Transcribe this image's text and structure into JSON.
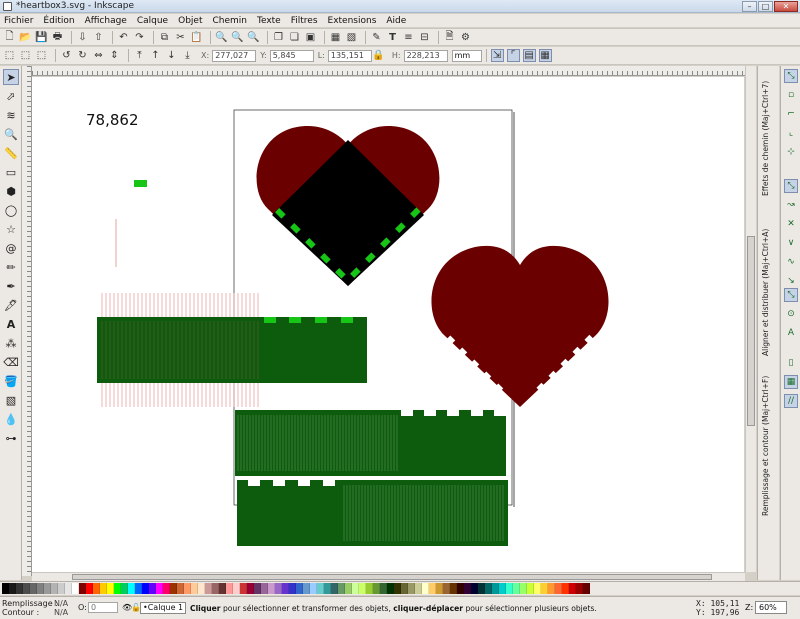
{
  "window": {
    "title": "*heartbox3.svg - Inkscape",
    "controls": [
      "–",
      "□",
      "✕"
    ]
  },
  "menu": [
    "Fichier",
    "Édition",
    "Affichage",
    "Calque",
    "Objet",
    "Chemin",
    "Texte",
    "Filtres",
    "Extensions",
    "Aide"
  ],
  "controls_bar": {
    "x_label": "X:",
    "x_value": "277,027",
    "y_label": "Y:",
    "y_value": "5,845",
    "w_label": "L:",
    "w_value": "135,151",
    "h_label": "H:",
    "h_value": "228,213",
    "unit": "mm"
  },
  "canvas": {
    "measure_text": "78,862"
  },
  "docks": {
    "fill_stroke": "Remplissage et contour (Maj+Ctrl+F)",
    "align": "Aligner et distribuer (Maj+Ctrl+A)",
    "path_effects": "Effets de chemin (Maj+Ctrl+7)"
  },
  "status": {
    "fill_label": "Remplissage :",
    "fill_value": "N/A",
    "stroke_label": "Contour :",
    "stroke_value": "N/A",
    "opacity_label": "O:",
    "opacity_value": "0",
    "layer": "•Calque 1",
    "msg_b1": "Cliquer",
    "msg_t1": " pour sélectionner et transformer des objets, ",
    "msg_b2": "cliquer-déplacer",
    "msg_t2": " pour sélectionner plusieurs objets.",
    "x_label": "X:",
    "x_value": "105,11",
    "y_label": "Y:",
    "y_value": "197,96",
    "zoom_label": "Z:",
    "zoom_value": "60%"
  },
  "colors": {
    "heart": "#6b0000",
    "board_green": "#0d5c0d",
    "tab_green": "#16c516",
    "cut_red": "#e8a3a3",
    "black": "#000000"
  },
  "palette": [
    "#000000",
    "#1a1a1a",
    "#333333",
    "#4d4d4d",
    "#666666",
    "#808080",
    "#999999",
    "#b3b3b3",
    "#cccccc",
    "#e6e6e6",
    "#ffffff",
    "#800000",
    "#ff0000",
    "#ff6600",
    "#ffcc00",
    "#ffff00",
    "#00ff00",
    "#00cc66",
    "#00ffff",
    "#0066ff",
    "#0000ff",
    "#6600ff",
    "#ff00ff",
    "#ff0066",
    "#993300",
    "#cc6633",
    "#ff9966",
    "#ffcc99",
    "#ffe6cc",
    "#cc9999",
    "#996666",
    "#663333",
    "#ff9999",
    "#ffcccc",
    "#cc3333",
    "#990033",
    "#663366",
    "#996699",
    "#cc99cc",
    "#9966cc",
    "#6633cc",
    "#3333cc",
    "#3366cc",
    "#6699cc",
    "#99ccff",
    "#66cccc",
    "#339999",
    "#336666",
    "#669966",
    "#99cc66",
    "#ccff99",
    "#ccff66",
    "#99cc33",
    "#669933",
    "#336633",
    "#003300",
    "#333300",
    "#666633",
    "#999966",
    "#cccc99",
    "#ffffcc",
    "#ffcc66",
    "#cc9933",
    "#996633",
    "#663300",
    "#330000",
    "#330033",
    "#000033",
    "#003333",
    "#006666",
    "#009999",
    "#00cccc",
    "#33ffcc",
    "#66ff99",
    "#99ff66",
    "#ccff33",
    "#ffff66",
    "#ffcc33",
    "#ff9933",
    "#ff6633",
    "#ff3300",
    "#cc0000",
    "#990000",
    "#660000"
  ]
}
